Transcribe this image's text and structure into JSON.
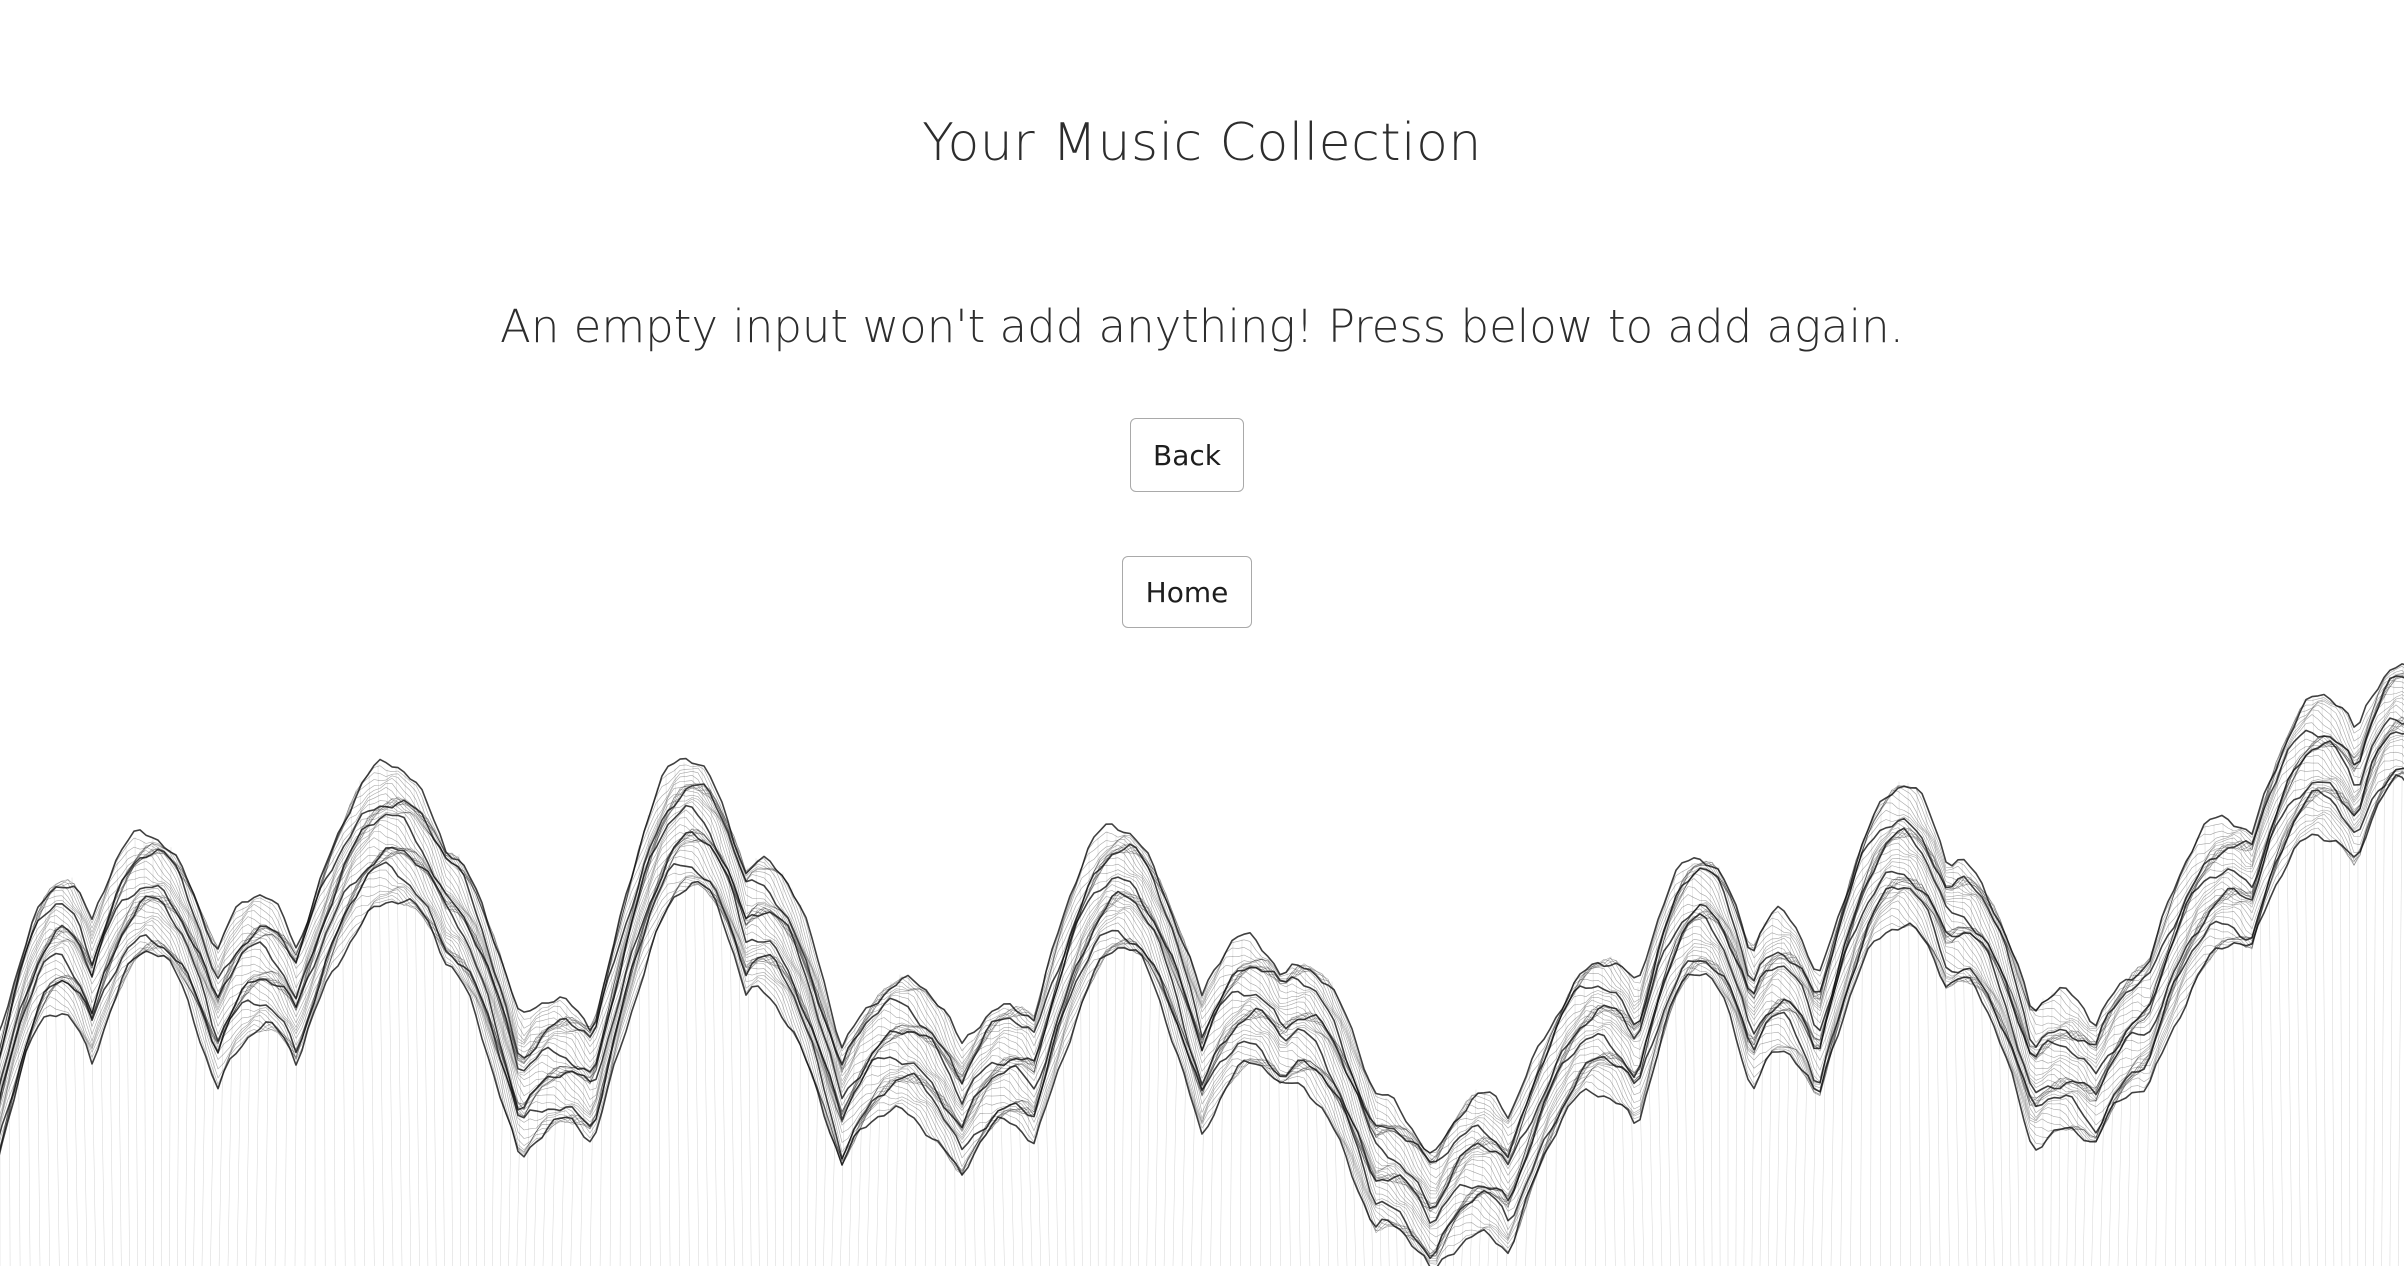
{
  "header": {
    "title": "Your Music Collection"
  },
  "main": {
    "message": "An empty input won't add anything! Press below to add again.",
    "back_label": "Back",
    "home_label": "Home"
  },
  "colors": {
    "background": "#ffffff",
    "text": "#2d2d2d",
    "button_border": "#a9a9a9",
    "terrain_line": "#000000"
  }
}
